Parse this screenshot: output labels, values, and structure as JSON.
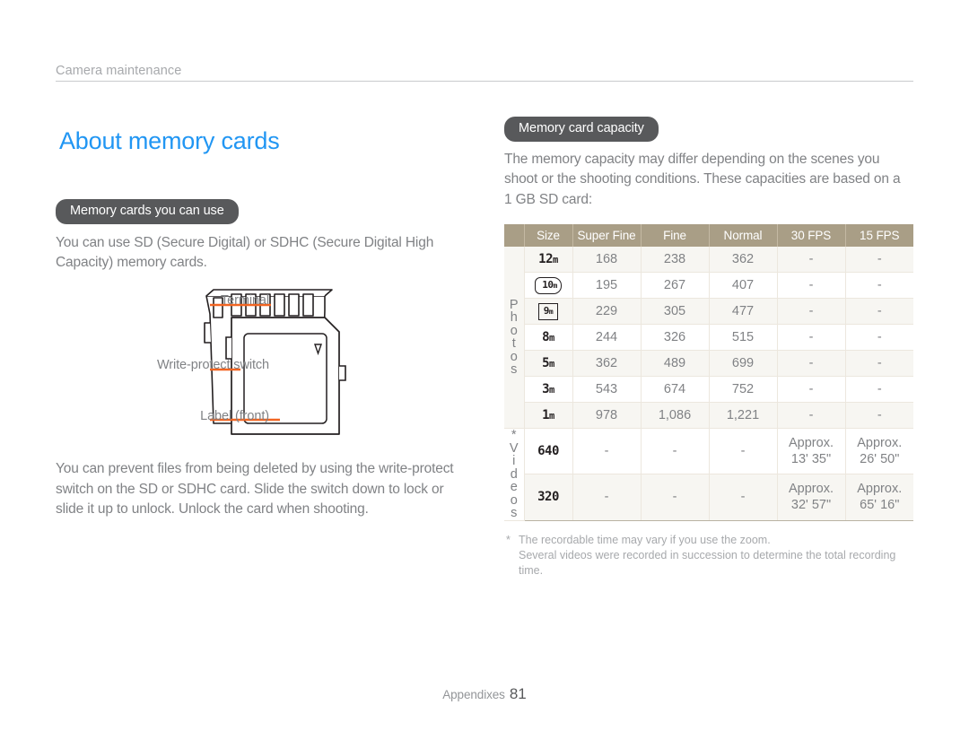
{
  "running_header": {
    "text": "Camera maintenance"
  },
  "left": {
    "title": "About memory cards",
    "section_pill": "Memory cards you can use",
    "intro": "You can use SD (Secure Digital) or SDHC (Secure Digital High Capacity) memory cards.",
    "figure_labels": {
      "terminal": "Terminal",
      "write_protect_switch": "Write-protect switch",
      "label_front": "Label (front)"
    },
    "outro": "You can prevent files from being deleted by using the write-protect switch on the SD or SDHC card. Slide the switch down to lock or slide it up to unlock. Unlock the card when shooting."
  },
  "right": {
    "section_pill": "Memory card capacity",
    "intro": "The memory capacity may differ depending on the scenes you shoot or the shooting conditions. These capacities are based on a 1 GB SD card:",
    "footnote": {
      "marker": "*",
      "line1": "The recordable time may vary if you use the zoom.",
      "line2": "Several videos were recorded in succession to determine the total recording time."
    }
  },
  "chart_data": {
    "type": "table",
    "title": "Memory card capacity",
    "subtitle": "Based on a 1 GB SD card",
    "columns": [
      "Size",
      "Super Fine",
      "Fine",
      "Normal",
      "30 FPS",
      "15 FPS"
    ],
    "group_labels": {
      "photos": [
        "P",
        "h",
        "o",
        "t",
        "o",
        "s"
      ],
      "videos": [
        "*",
        "V",
        "i",
        "d",
        "e",
        "o",
        "s"
      ]
    },
    "rows": [
      {
        "group": "Photos",
        "size_value": "12",
        "size_unit": "m",
        "size_style": "plain",
        "cells": [
          "168",
          "238",
          "362",
          "-",
          "-"
        ]
      },
      {
        "group": "Photos",
        "size_value": "10",
        "size_unit": "m",
        "size_style": "boxed-round",
        "cells": [
          "195",
          "267",
          "407",
          "-",
          "-"
        ]
      },
      {
        "group": "Photos",
        "size_value": "9",
        "size_unit": "m",
        "size_style": "boxed-rect",
        "cells": [
          "229",
          "305",
          "477",
          "-",
          "-"
        ]
      },
      {
        "group": "Photos",
        "size_value": "8",
        "size_unit": "m",
        "size_style": "plain",
        "cells": [
          "244",
          "326",
          "515",
          "-",
          "-"
        ]
      },
      {
        "group": "Photos",
        "size_value": "5",
        "size_unit": "m",
        "size_style": "plain",
        "cells": [
          "362",
          "489",
          "699",
          "-",
          "-"
        ]
      },
      {
        "group": "Photos",
        "size_value": "3",
        "size_unit": "m",
        "size_style": "plain",
        "cells": [
          "543",
          "674",
          "752",
          "-",
          "-"
        ]
      },
      {
        "group": "Photos",
        "size_value": "1",
        "size_unit": "m",
        "size_style": "plain",
        "cells": [
          "978",
          "1,086",
          "1,221",
          "-",
          "-"
        ]
      },
      {
        "group": "Videos",
        "size_value": "640",
        "size_unit": "",
        "size_style": "plain",
        "cells": [
          "-",
          "-",
          "-",
          "Approx. 13' 35\"",
          "Approx. 26' 50\""
        ]
      },
      {
        "group": "Videos",
        "size_value": "320",
        "size_unit": "",
        "size_style": "plain",
        "cells": [
          "-",
          "-",
          "-",
          "Approx. 32' 57\"",
          "Approx. 65' 16\""
        ]
      }
    ],
    "video_cells_split": [
      {
        "col": "30 FPS",
        "row": "640",
        "l1": "Approx.",
        "l2": "13' 35\""
      },
      {
        "col": "15 FPS",
        "row": "640",
        "l1": "Approx.",
        "l2": "26' 50\""
      },
      {
        "col": "30 FPS",
        "row": "320",
        "l1": "Approx.",
        "l2": "32' 57\""
      },
      {
        "col": "15 FPS",
        "row": "320",
        "l1": "Approx.",
        "l2": "65' 16\""
      }
    ]
  },
  "footer": {
    "label": "Appendixes",
    "page": "81"
  },
  "colors": {
    "title_blue": "#2196f3",
    "pill_gray": "#58595b",
    "table_header": "#a99e86",
    "leader_orange": "#f26522",
    "body_gray": "#808285"
  }
}
